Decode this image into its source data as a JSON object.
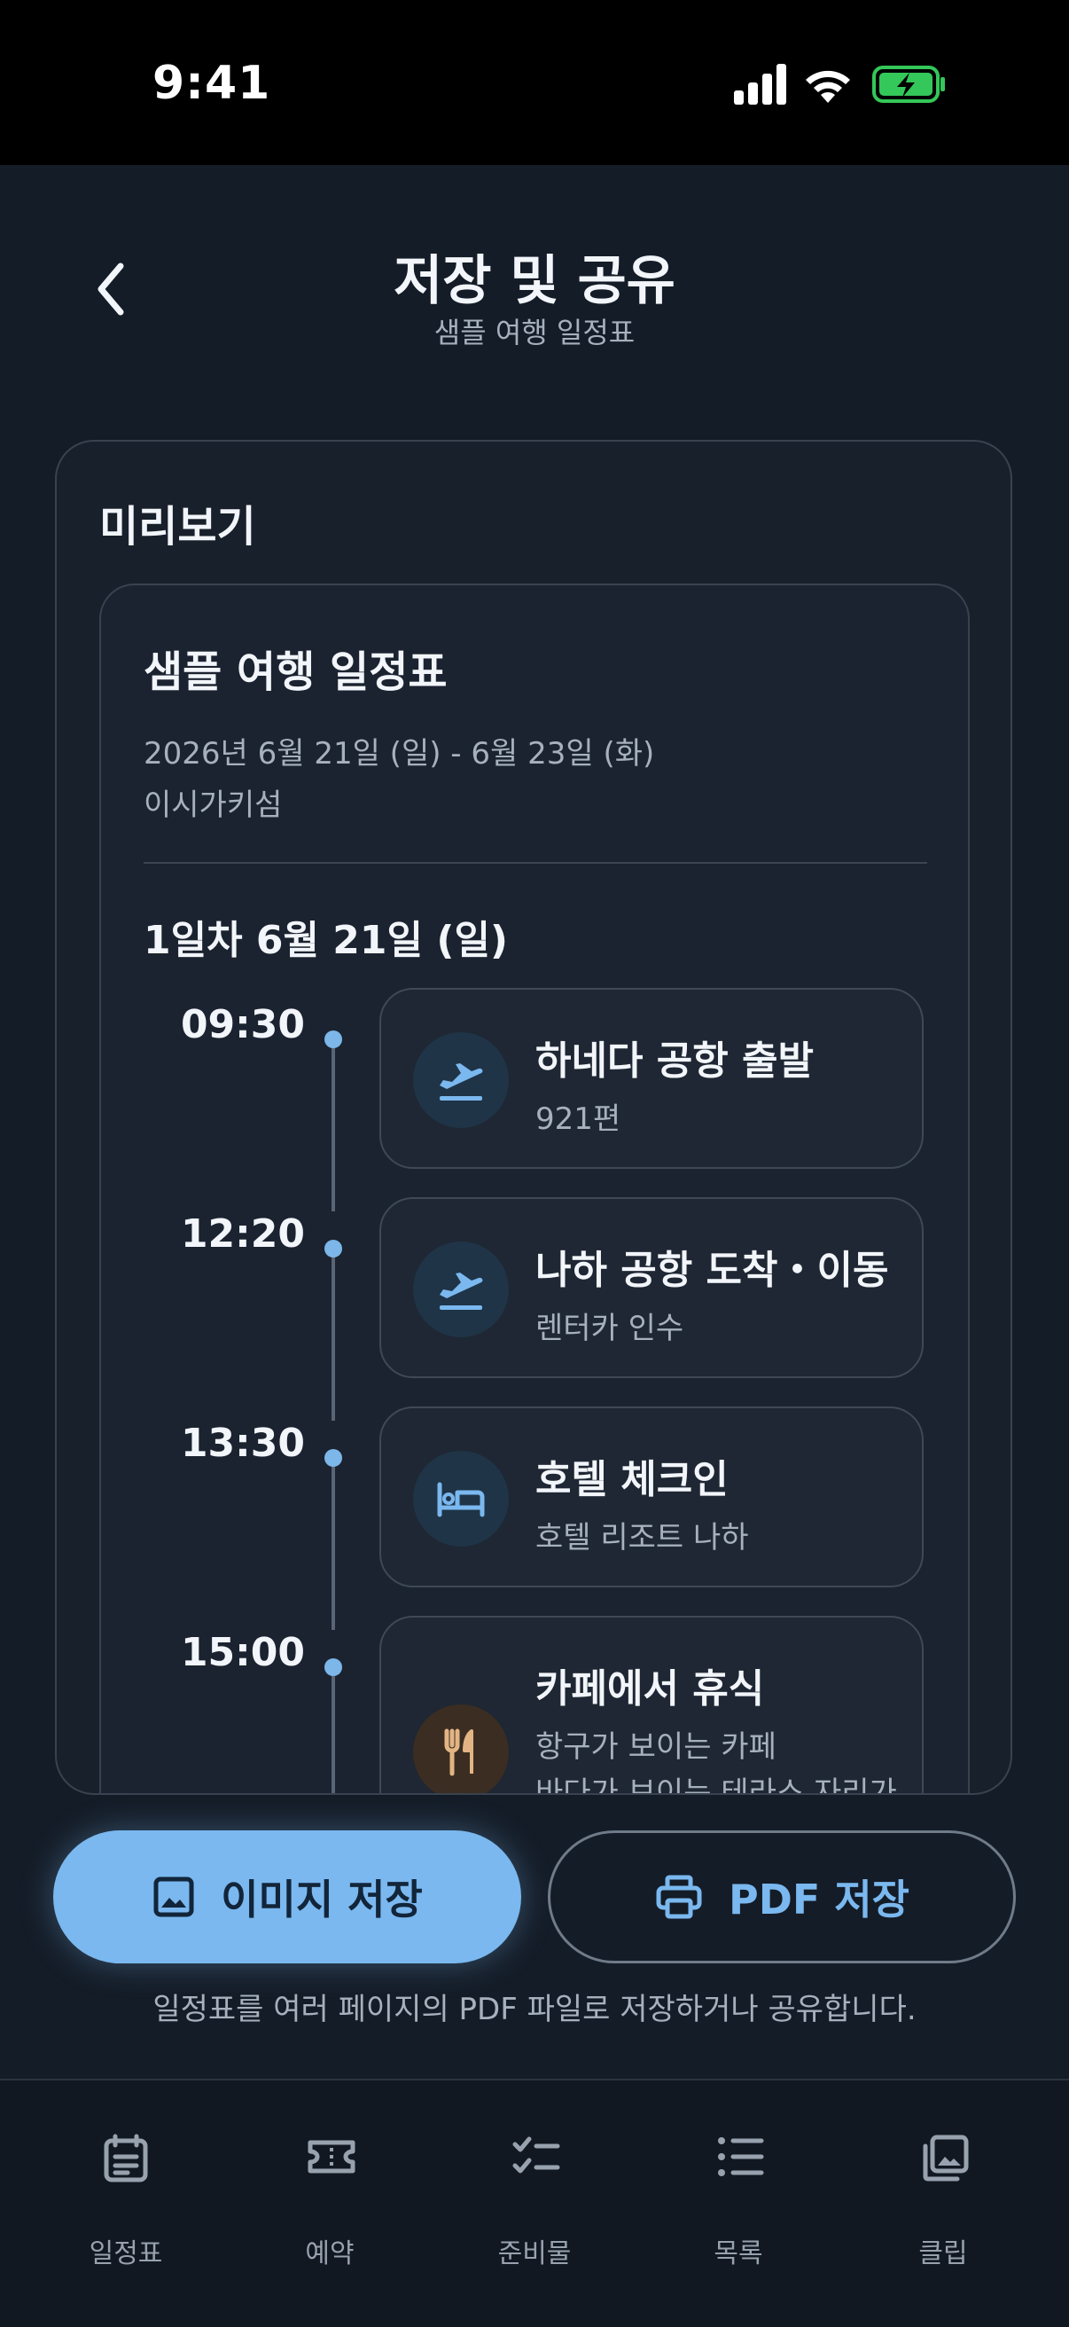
{
  "status": {
    "time": "9:41"
  },
  "header": {
    "title": "저장 및 공유",
    "subtitle": "샘플 여행 일정표"
  },
  "preview": {
    "label": "미리보기",
    "doc": {
      "title": "샘플 여행 일정표",
      "dates": "2026년 6월 21일 (일) - 6월 23일 (화)",
      "place": "이시가키섬",
      "day_heading": "1일차 6월 21일 (일)",
      "events": [
        {
          "time": "09:30",
          "icon": "plane-icon",
          "title": "하네다 공항 출발",
          "sub": "921편"
        },
        {
          "time": "12:20",
          "icon": "plane-icon",
          "title": "나하 공항 도착・이동",
          "sub": "렌터카 인수"
        },
        {
          "time": "13:30",
          "icon": "bed-icon",
          "title": "호텔 체크인",
          "sub": "호텔 리조트 나하"
        },
        {
          "time": "15:00",
          "icon": "food-icon",
          "title": "카페에서 휴식",
          "sub": "항구가 보이는 카페",
          "sub2": "바다가 보이는 테라스 자리가"
        }
      ]
    }
  },
  "actions": {
    "save_image": "이미지 저장",
    "save_pdf": "PDF 저장",
    "hint": "일정표를 여러 페이지의 PDF 파일로 저장하거나 공유합니다."
  },
  "tabs": [
    {
      "label": "일정표",
      "icon": "calendar-icon"
    },
    {
      "label": "예약",
      "icon": "ticket-icon"
    },
    {
      "label": "준비물",
      "icon": "checklist-icon"
    },
    {
      "label": "목록",
      "icon": "list-icon"
    },
    {
      "label": "클립",
      "icon": "gallery-icon"
    }
  ],
  "colors": {
    "background": "#141c27",
    "accent": "#7ab8ef",
    "battery": "#34c759"
  }
}
